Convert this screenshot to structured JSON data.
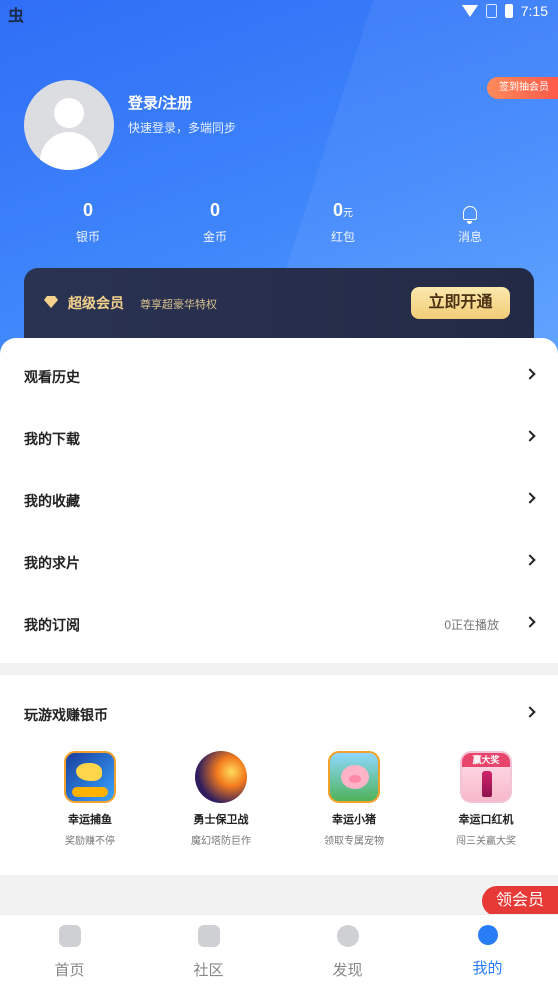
{
  "status_bar": {
    "app_glyph": "虫",
    "time": "7:15"
  },
  "profile": {
    "title": "登录/注册",
    "subtitle": "快速登录，多端同步",
    "signin_badge": "签到抽会员"
  },
  "stats": [
    {
      "value": "0",
      "unit": "",
      "label": "银币"
    },
    {
      "value": "0",
      "unit": "",
      "label": "金币"
    },
    {
      "value": "0",
      "unit": "元",
      "label": "红包"
    },
    {
      "value": "",
      "unit": "",
      "label": "消息"
    }
  ],
  "vip": {
    "title": "超级会员",
    "subtitle": "尊享超豪华特权",
    "button": "立即开通"
  },
  "menu": [
    {
      "label": "观看历史",
      "extra": ""
    },
    {
      "label": "我的下载",
      "extra": ""
    },
    {
      "label": "我的收藏",
      "extra": ""
    },
    {
      "label": "我的求片",
      "extra": ""
    },
    {
      "label": "我的订阅",
      "extra": "0正在播放"
    }
  ],
  "games": {
    "title": "玩游戏赚银币",
    "items": [
      {
        "name": "幸运捕鱼",
        "desc": "奖励赚不停",
        "icon": "fishing-game-icon"
      },
      {
        "name": "勇士保卫战",
        "desc": "魔幻塔防巨作",
        "icon": "warrior-game-icon"
      },
      {
        "name": "幸运小猪",
        "desc": "领取专属宠物",
        "icon": "pig-game-icon"
      },
      {
        "name": "幸运口红机",
        "desc": "闯三关赢大奖",
        "icon": "lipstick-game-icon",
        "banner": "赢大奖"
      }
    ]
  },
  "float_button": "领会员",
  "tabs": [
    {
      "label": "首页",
      "active": false
    },
    {
      "label": "社区",
      "active": false
    },
    {
      "label": "发现",
      "active": false
    },
    {
      "label": "我的",
      "active": true
    }
  ],
  "colors": {
    "brand_blue": "#2a7cf6",
    "vip_gold": "#f4d28c",
    "accent_red": "#e73a36"
  }
}
